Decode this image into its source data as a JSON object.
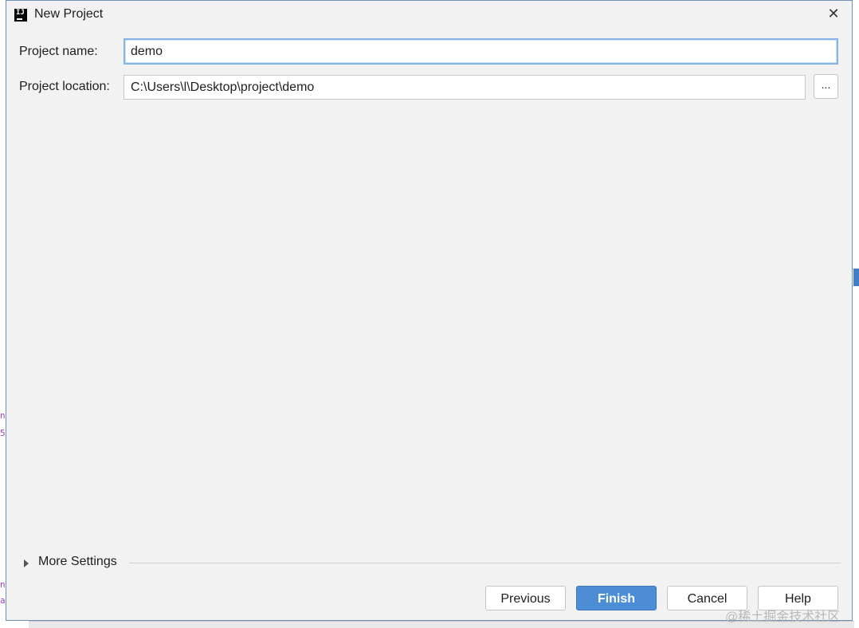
{
  "window": {
    "title": "New Project",
    "close_glyph": "✕",
    "app_icon": "intellij-icon",
    "app_icon_text": "IJ"
  },
  "form": {
    "project_name_label": "Project name:",
    "project_name_value": "demo",
    "project_location_label": "Project location:",
    "project_location_value": "C:\\Users\\l\\Desktop\\project\\demo",
    "browse_label": "..."
  },
  "more_settings": {
    "label": "More Settings",
    "expanded": false
  },
  "buttons": {
    "previous": "Previous",
    "finish": "Finish",
    "cancel": "Cancel",
    "help": "Help"
  },
  "colors": {
    "accent": "#4d8dd6",
    "focus_border": "#85b5e6",
    "dialog_bg": "#f2f2f2"
  },
  "watermark": "@稀土掘金技术社区"
}
